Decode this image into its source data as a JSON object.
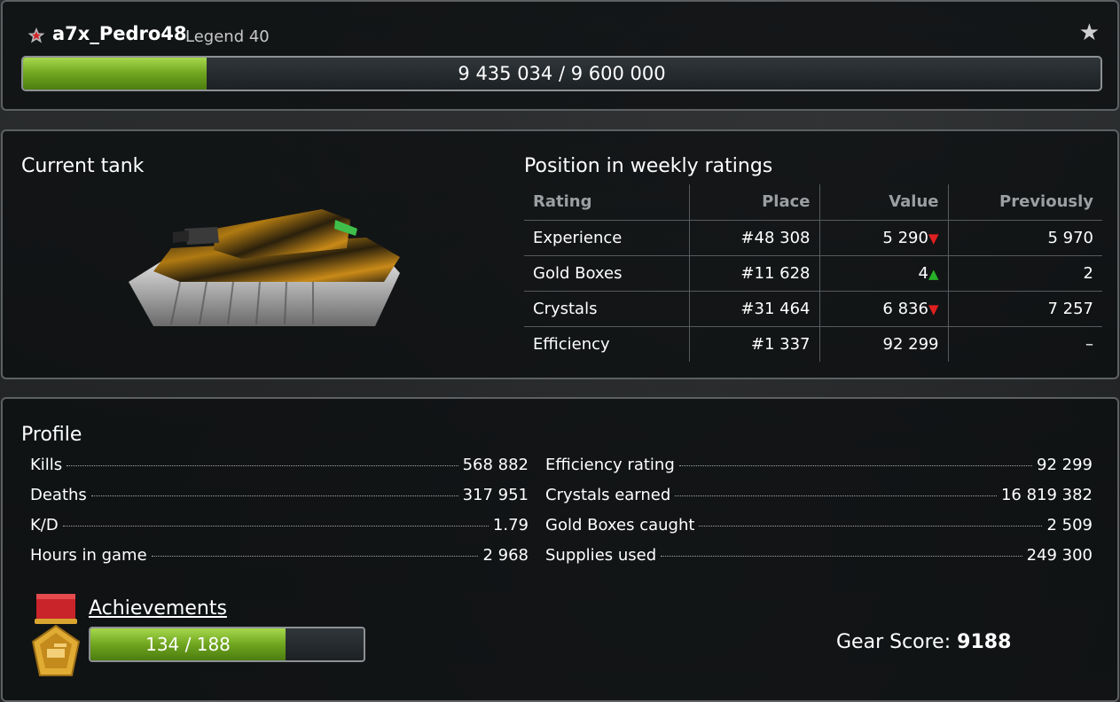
{
  "header": {
    "nickname": "a7x_Pedro48",
    "rank": "Legend 40",
    "experience_text": "9 435 034 / 9 600 000",
    "experience_current": 9435034,
    "experience_total": 9600000
  },
  "tank": {
    "title": "Current tank"
  },
  "ratings": {
    "title": "Position in weekly ratings",
    "columns": [
      "Rating",
      "Place",
      "Value",
      "Previously"
    ],
    "rows": [
      {
        "name": "Experience",
        "place": "#48 308",
        "value": "5 290",
        "trend": "down",
        "previous": "5 970"
      },
      {
        "name": "Gold Boxes",
        "place": "#11 628",
        "value": "4",
        "trend": "up",
        "previous": "2"
      },
      {
        "name": "Crystals",
        "place": "#31 464",
        "value": "6 836",
        "trend": "down",
        "previous": "7 257"
      },
      {
        "name": "Efficiency",
        "place": "#1 337",
        "value": "92 299",
        "trend": "none",
        "previous": "–"
      }
    ]
  },
  "profile": {
    "title": "Profile",
    "left_stats": [
      {
        "label": "Kills",
        "value": "568 882"
      },
      {
        "label": "Deaths",
        "value": "317 951"
      },
      {
        "label": "K/D",
        "value": "1.79"
      },
      {
        "label": "Hours in game",
        "value": "2 968"
      }
    ],
    "right_stats": [
      {
        "label": "Efficiency rating",
        "value": "92 299"
      },
      {
        "label": "Crystals earned",
        "value": "16 819 382"
      },
      {
        "label": "Gold Boxes caught",
        "value": "2 509"
      },
      {
        "label": "Supplies used",
        "value": "249 300"
      }
    ],
    "achievements_label": "Achievements",
    "achievements_text": "134 / 188",
    "achievements_current": 134,
    "achievements_total": 188,
    "gear_score_label": "Gear Score:",
    "gear_score_value": "9188"
  },
  "colors": {
    "progress_green": "#6fa51f",
    "trend_down": "#e02020",
    "trend_up": "#27b027"
  },
  "icons": [
    "rank-star-icon",
    "favorite-star-icon",
    "trend-down-icon",
    "trend-up-icon",
    "medal-icon"
  ]
}
